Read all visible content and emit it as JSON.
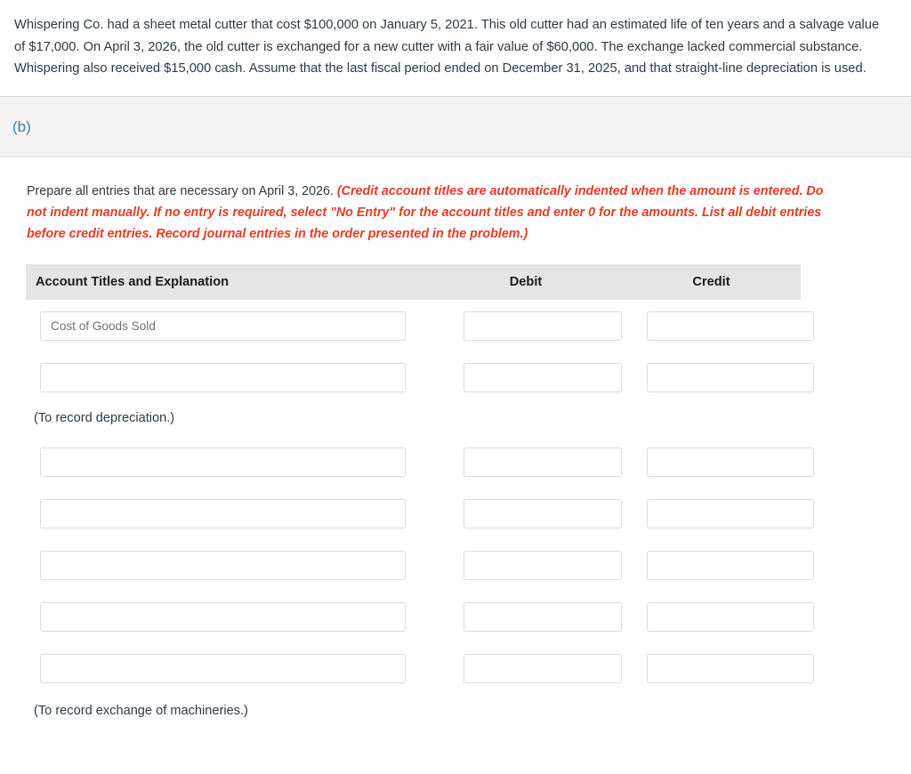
{
  "problem": {
    "text": "Whispering Co. had a sheet metal cutter that cost $100,000 on January 5, 2021. This old cutter had an estimated life of ten years and a salvage value of $17,000. On April 3, 2026, the old cutter is exchanged for a new cutter with a fair value of $60,000. The exchange lacked commercial substance. Whispering also received $15,000 cash. Assume that the last fiscal period ended on December 31, 2025, and that straight-line depreciation is used."
  },
  "part": {
    "label": "(b)",
    "label_color": "#3d7fab"
  },
  "instruction": {
    "lead": "Prepare all entries that are necessary on April 3, 2026. ",
    "emphasis": "(Credit account titles are automatically indented when the amount is entered. Do not indent manually. If no entry is required, select \"No Entry\" for the account titles and enter 0 for the amounts. List all debit entries before credit entries. Record journal entries in the order presented in the problem.)",
    "emphasis_color": "#ea3a23"
  },
  "journal": {
    "headers": {
      "account": "Account Titles and Explanation",
      "debit": "Debit",
      "credit": "Credit"
    },
    "header_bg": "#e5e5e5",
    "field_border": "#dcdcdc",
    "blocks": [
      {
        "rows": [
          {
            "account": "Cost of Goods Sold",
            "debit": "",
            "credit": ""
          },
          {
            "account": "",
            "debit": "",
            "credit": ""
          }
        ],
        "caption": "(To record depreciation.)"
      },
      {
        "rows": [
          {
            "account": "",
            "debit": "",
            "credit": ""
          },
          {
            "account": "",
            "debit": "",
            "credit": ""
          },
          {
            "account": "",
            "debit": "",
            "credit": ""
          },
          {
            "account": "",
            "debit": "",
            "credit": ""
          },
          {
            "account": "",
            "debit": "",
            "credit": ""
          }
        ],
        "caption": "(To record exchange of machineries.)"
      }
    ]
  }
}
